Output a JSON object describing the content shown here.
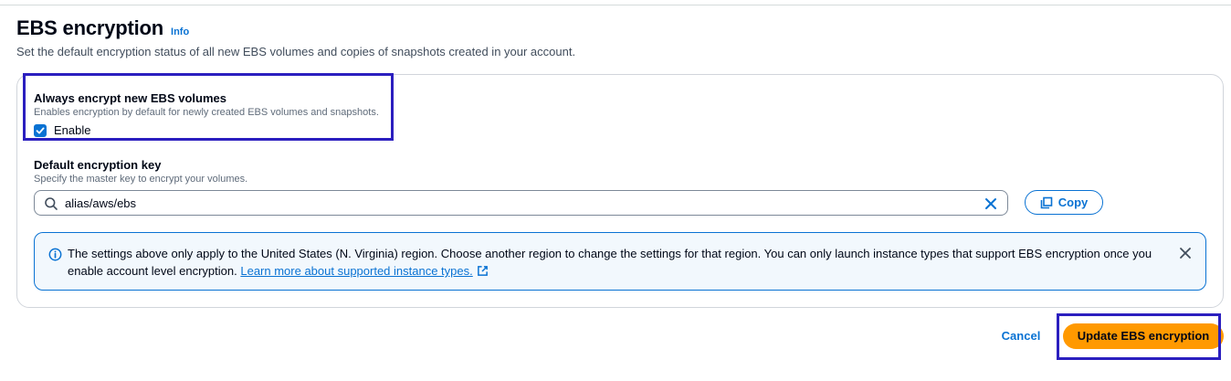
{
  "page": {
    "title": "EBS encryption",
    "info_link": "Info",
    "description": "Set the default encryption status of all new EBS volumes and copies of snapshots created in your account."
  },
  "always_encrypt": {
    "label": "Always encrypt new EBS volumes",
    "description": "Enables encryption by default for newly created EBS volumes and snapshots.",
    "checkbox_label": "Enable",
    "checked": true
  },
  "encryption_key": {
    "label": "Default encryption key",
    "description": "Specify the master key to encrypt your volumes.",
    "value": "alias/aws/ebs",
    "copy_label": "Copy"
  },
  "alert": {
    "text": "The settings above only apply to the United States (N. Virginia) region. Choose another region to change the settings for that region. You can only launch instance types that support EBS encryption once you enable account level encryption.",
    "link_text": "Learn more about supported instance types."
  },
  "footer": {
    "cancel_label": "Cancel",
    "submit_label": "Update EBS encryption"
  },
  "colors": {
    "accent": "#0972d3",
    "primary_button": "#ff9900",
    "highlight_box": "#2b1fbf",
    "alert_bg": "#f2f8fd"
  },
  "icons": {
    "info": "info-circle-icon",
    "search": "search-icon",
    "clear": "close-icon",
    "copy": "copy-icon",
    "external": "external-link-icon",
    "dismiss": "close-icon",
    "check": "check-icon"
  }
}
